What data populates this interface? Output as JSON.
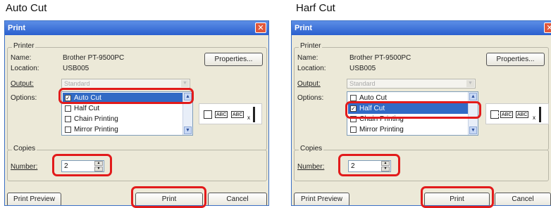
{
  "captions": {
    "left": "Auto Cut",
    "right": "Harf Cut"
  },
  "colors": {
    "highlight": "#e21b1b",
    "selection": "#316ac5",
    "titlebar": "#2a5fce"
  },
  "dialogs": [
    {
      "id": "auto",
      "title": "Print",
      "printer_group": "Printer",
      "name_label": "Name:",
      "name_value": "Brother PT-9500PC",
      "location_label": "Location:",
      "location_value": "USB005",
      "output_label": "Output:",
      "output_value": "Standard",
      "options_label": "Options:",
      "properties_label": "Properties...",
      "options": [
        {
          "label": "Auto Cut",
          "checked": true,
          "selected": true
        },
        {
          "label": "Half Cut",
          "checked": false,
          "selected": false
        },
        {
          "label": "Chain Printing",
          "checked": false,
          "selected": false
        },
        {
          "label": "Mirror Printing",
          "checked": false,
          "selected": false
        }
      ],
      "preview_text": "ABC",
      "preview_multiplier": "x",
      "copies_group": "Copies",
      "number_label": "Number:",
      "number_value": "2",
      "print_preview": "Print Preview",
      "print": "Print",
      "cancel": "Cancel"
    },
    {
      "id": "half",
      "title": "Print",
      "printer_group": "Printer",
      "name_label": "Name:",
      "name_value": "Brother PT-9500PC",
      "location_label": "Location:",
      "location_value": "USB005",
      "output_label": "Output:",
      "output_value": "Standard",
      "options_label": "Options:",
      "properties_label": "Properties...",
      "options": [
        {
          "label": "Auto Cut",
          "checked": false,
          "selected": false
        },
        {
          "label": "Half Cut",
          "checked": true,
          "selected": true
        },
        {
          "label": "Chain Printing",
          "checked": false,
          "selected": false
        },
        {
          "label": "Mirror Printing",
          "checked": false,
          "selected": false
        }
      ],
      "preview_text": "ABC",
      "preview_multiplier": "x",
      "copies_group": "Copies",
      "number_label": "Number:",
      "number_value": "2",
      "print_preview": "Print Preview",
      "print": "Print",
      "cancel": "Cancel"
    }
  ]
}
